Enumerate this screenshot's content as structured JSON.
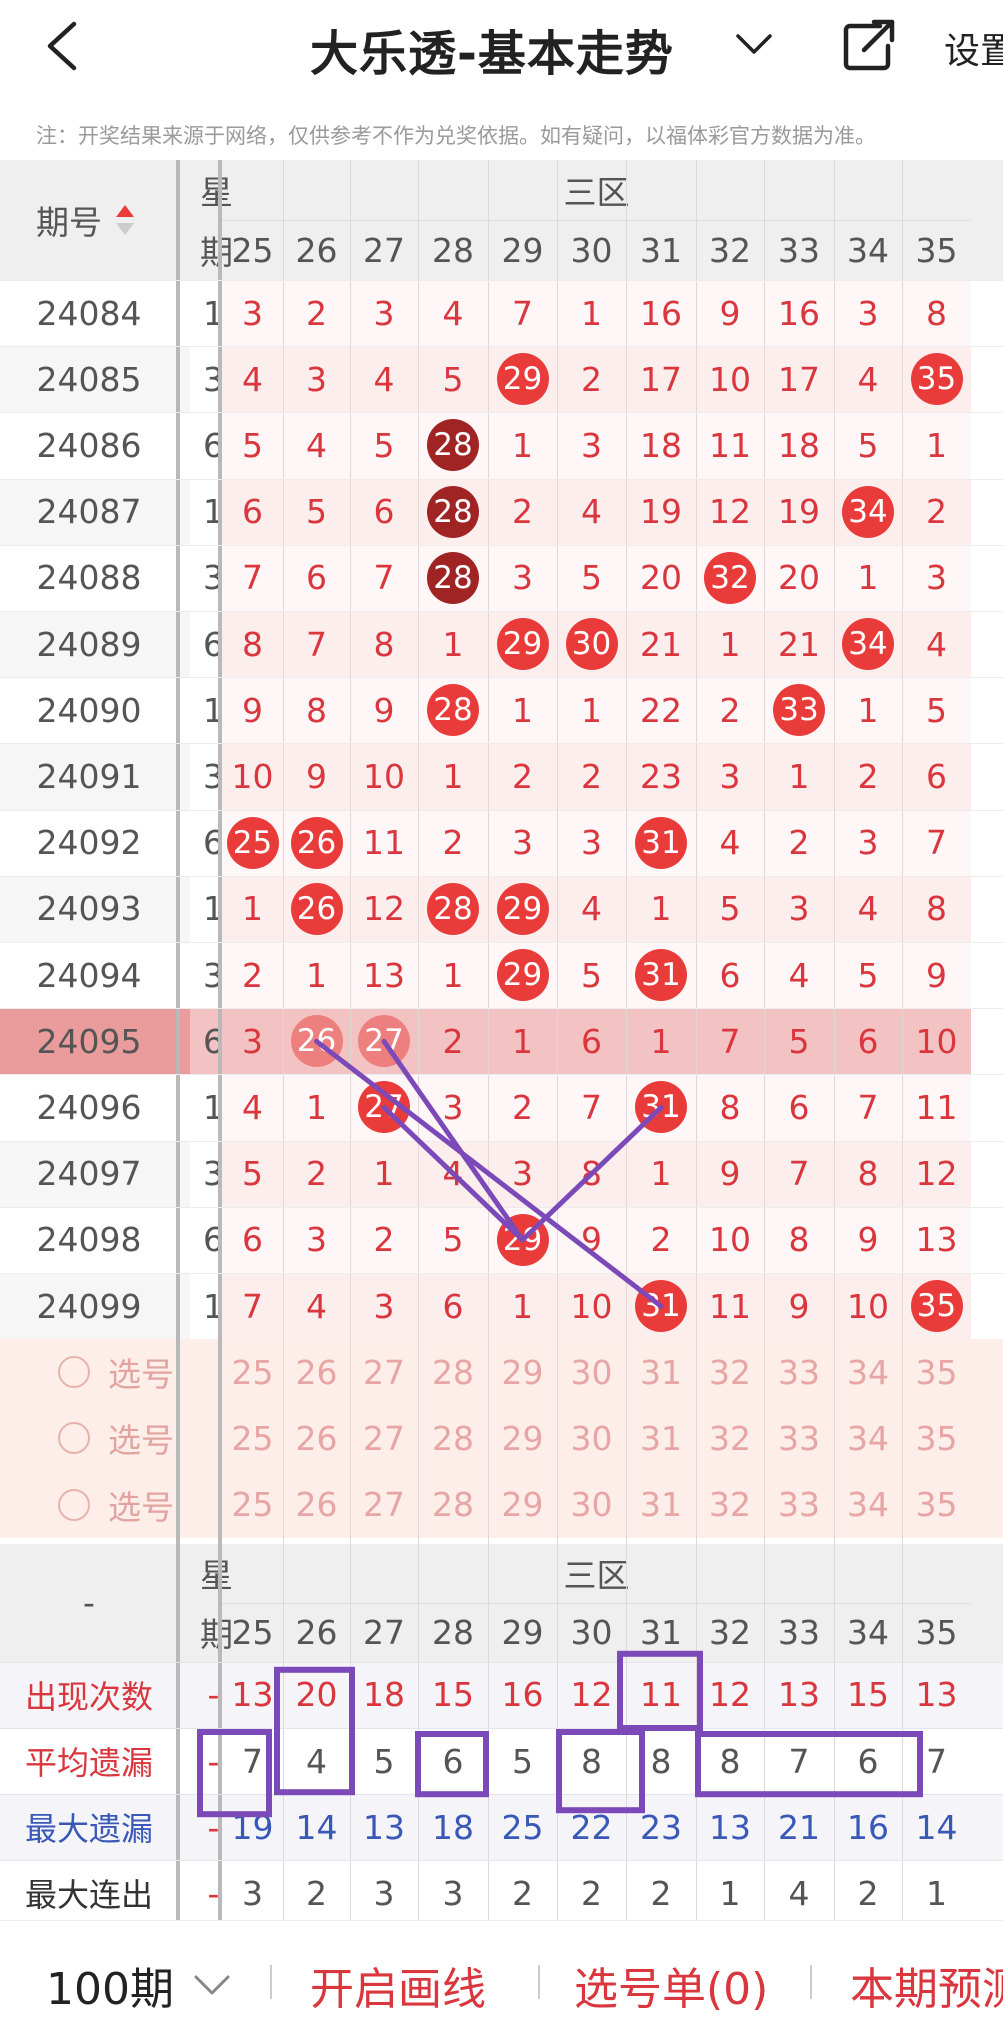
{
  "header": {
    "title": "大乐透-基本走势",
    "settings_label": "设置"
  },
  "notice": "注：开奖结果来源于网络，仅供参考不作为兑奖依据。如有疑问，以福体彩官方数据为准。",
  "table": {
    "col_period": "期号",
    "col_weekday_top": "星",
    "col_weekday_bottom": "期",
    "zone_label": "三区",
    "numbers": [
      "25",
      "26",
      "27",
      "28",
      "29",
      "30",
      "31",
      "32",
      "33",
      "34",
      "35"
    ],
    "rows": [
      {
        "period": "24084",
        "weekday": "1",
        "cells": [
          "3",
          "2",
          "3",
          "4",
          "7",
          "1",
          "16",
          "9",
          "16",
          "3",
          "8"
        ]
      },
      {
        "period": "24085",
        "weekday": "3",
        "cells": [
          "4",
          "3",
          "4",
          "5",
          "29",
          "2",
          "17",
          "10",
          "17",
          "4",
          "35"
        ]
      },
      {
        "period": "24086",
        "weekday": "6",
        "cells": [
          "5",
          "4",
          "5",
          "28",
          "1",
          "3",
          "18",
          "11",
          "18",
          "5",
          "1"
        ]
      },
      {
        "period": "24087",
        "weekday": "1",
        "cells": [
          "6",
          "5",
          "6",
          "28",
          "2",
          "4",
          "19",
          "12",
          "19",
          "34",
          "2"
        ]
      },
      {
        "period": "24088",
        "weekday": "3",
        "cells": [
          "7",
          "6",
          "7",
          "28",
          "3",
          "5",
          "20",
          "32",
          "20",
          "1",
          "3"
        ]
      },
      {
        "period": "24089",
        "weekday": "6",
        "cells": [
          "8",
          "7",
          "8",
          "1",
          "29",
          "30",
          "21",
          "1",
          "21",
          "34",
          "4"
        ]
      },
      {
        "period": "24090",
        "weekday": "1",
        "cells": [
          "9",
          "8",
          "9",
          "28",
          "1",
          "1",
          "22",
          "2",
          "33",
          "1",
          "5"
        ]
      },
      {
        "period": "24091",
        "weekday": "3",
        "cells": [
          "10",
          "9",
          "10",
          "1",
          "2",
          "2",
          "23",
          "3",
          "1",
          "2",
          "6"
        ]
      },
      {
        "period": "24092",
        "weekday": "6",
        "cells": [
          "25",
          "26",
          "11",
          "2",
          "3",
          "3",
          "31",
          "4",
          "2",
          "3",
          "7"
        ]
      },
      {
        "period": "24093",
        "weekday": "1",
        "cells": [
          "1",
          "26",
          "12",
          "28",
          "29",
          "4",
          "1",
          "5",
          "3",
          "4",
          "8"
        ]
      },
      {
        "period": "24094",
        "weekday": "3",
        "cells": [
          "2",
          "1",
          "13",
          "1",
          "29",
          "5",
          "31",
          "6",
          "4",
          "5",
          "9"
        ]
      },
      {
        "period": "24095",
        "weekday": "6",
        "cells": [
          "3",
          "26",
          "27",
          "2",
          "1",
          "6",
          "1",
          "7",
          "5",
          "6",
          "10"
        ]
      },
      {
        "period": "24096",
        "weekday": "1",
        "cells": [
          "4",
          "1",
          "27",
          "3",
          "2",
          "7",
          "31",
          "8",
          "6",
          "7",
          "11"
        ]
      },
      {
        "period": "24097",
        "weekday": "3",
        "cells": [
          "5",
          "2",
          "1",
          "4",
          "3",
          "8",
          "1",
          "9",
          "7",
          "8",
          "12"
        ]
      },
      {
        "period": "24098",
        "weekday": "6",
        "cells": [
          "6",
          "3",
          "2",
          "5",
          "29",
          "9",
          "2",
          "10",
          "8",
          "9",
          "13"
        ]
      },
      {
        "period": "24099",
        "weekday": "1",
        "cells": [
          "7",
          "4",
          "3",
          "6",
          "1",
          "10",
          "31",
          "11",
          "9",
          "10",
          "35"
        ]
      }
    ],
    "select_label": "选号",
    "select_rows": 3
  },
  "stats": {
    "dash": "-",
    "rows": [
      {
        "label": "出现次数",
        "values": [
          "13",
          "20",
          "18",
          "15",
          "16",
          "12",
          "11",
          "12",
          "13",
          "15",
          "13"
        ]
      },
      {
        "label": "平均遗漏",
        "values": [
          "7",
          "4",
          "5",
          "6",
          "5",
          "8",
          "8",
          "8",
          "7",
          "6",
          "7"
        ]
      },
      {
        "label": "最大遗漏",
        "values": [
          "19",
          "14",
          "13",
          "18",
          "25",
          "22",
          "23",
          "13",
          "21",
          "16",
          "14"
        ]
      },
      {
        "label": "最大连出",
        "values": [
          "3",
          "2",
          "3",
          "3",
          "2",
          "2",
          "2",
          "1",
          "4",
          "2",
          "1"
        ]
      }
    ]
  },
  "footer": {
    "period_count": "100期",
    "draw_line": "开启画线",
    "selection_list": "选号单(0)",
    "forecast": "本期预测"
  },
  "colors": {
    "hit_ball": "#ea3b3b",
    "streak_ball": "#a12424",
    "highlight_row": "#f3c3c3",
    "annotation": "#7b4ab8",
    "stat_label": "#c5303a",
    "max_miss": "#3958b7"
  }
}
